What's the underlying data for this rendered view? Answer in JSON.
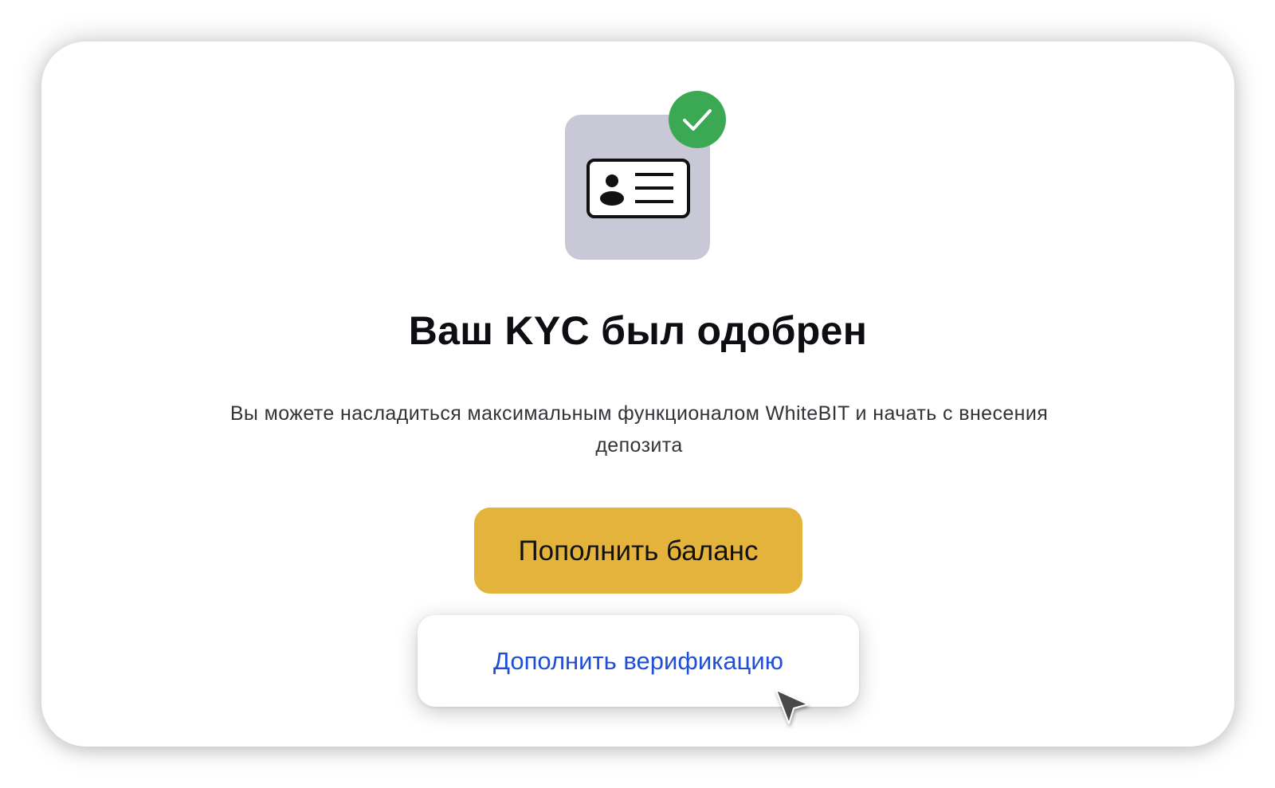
{
  "dialog": {
    "title": "Ваш KYC был одобрен",
    "description": "Вы можете насладиться максимальным функционалом WhiteBIT и начать с внесения депозита",
    "primary_button": "Пополнить баланс",
    "secondary_button": "Дополнить верификацию"
  },
  "icons": {
    "document": "id-card-icon",
    "status": "check-icon",
    "pointer": "mouse-cursor-icon"
  },
  "colors": {
    "tile": "#c8c8d6",
    "success": "#3ba853",
    "primary_button": "#e4b33c",
    "link": "#1f4fd8"
  }
}
